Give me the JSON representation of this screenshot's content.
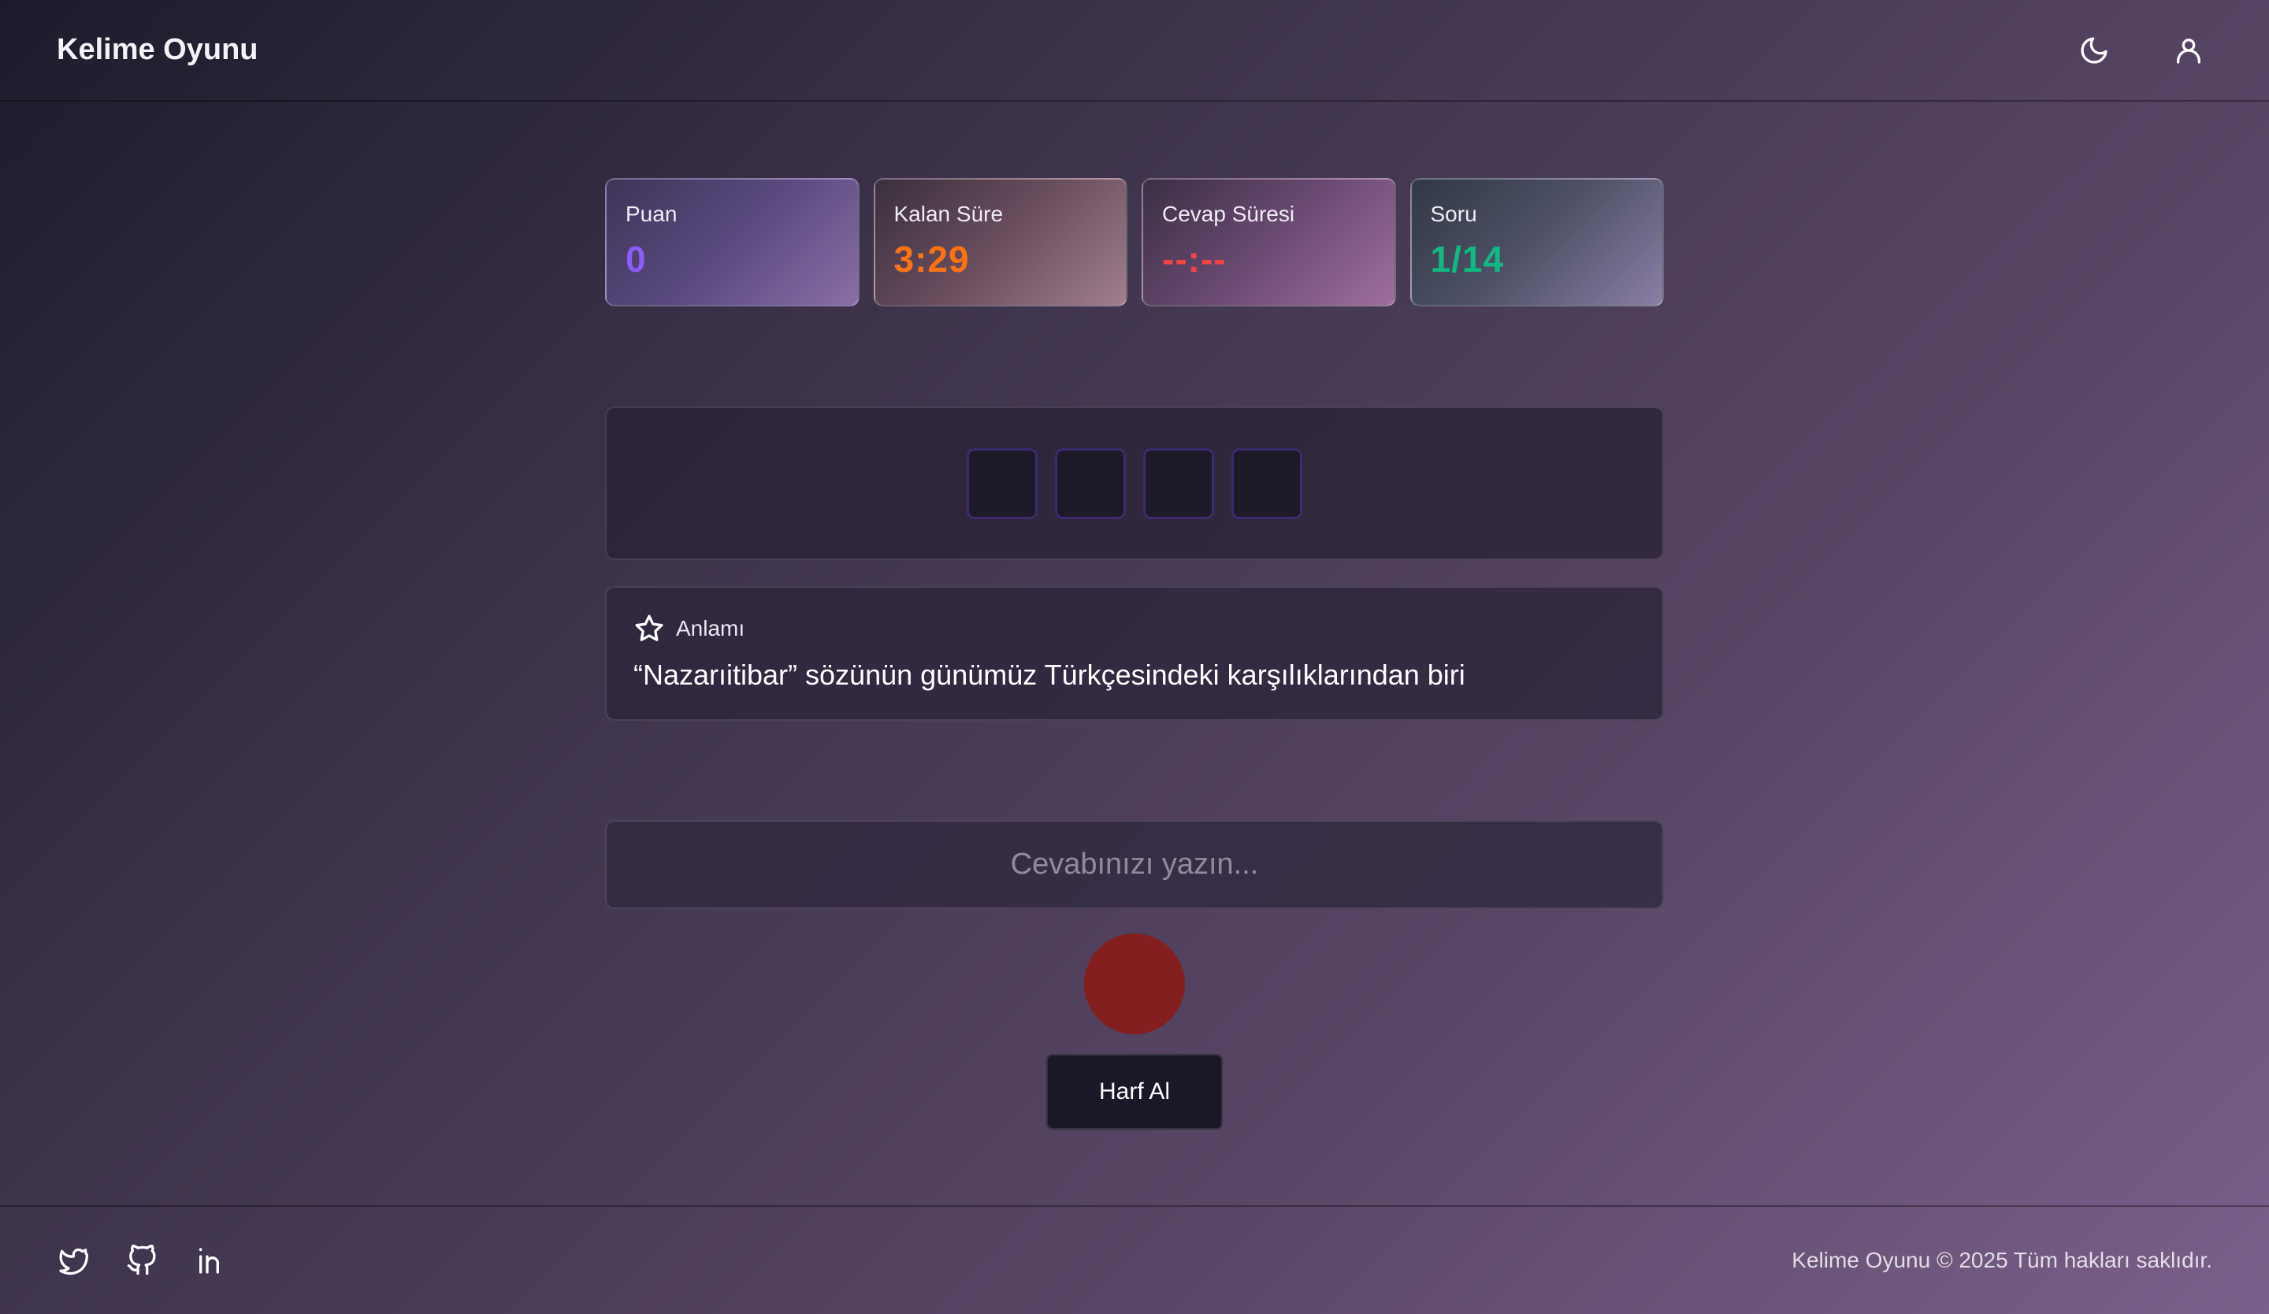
{
  "header": {
    "title": "Kelime Oyunu",
    "icons": [
      "moon-icon",
      "user-icon"
    ]
  },
  "stats": [
    {
      "label": "Puan",
      "value": "0",
      "color": "#8b5cf6"
    },
    {
      "label": "Kalan Süre",
      "value": "3:29",
      "color": "#f97316"
    },
    {
      "label": "Cevap Süresi",
      "value": "--:--",
      "color": "#ef4444"
    },
    {
      "label": "Soru",
      "value": "1/14",
      "color": "#10b981"
    }
  ],
  "board": {
    "letter_count": 4,
    "letters": [
      "",
      "",
      "",
      ""
    ]
  },
  "meaning": {
    "label": "Anlamı",
    "icon": "star-icon",
    "text": "“Nazarıitibar” sözünün günümüz Türkçesindeki karşılıklarından biri"
  },
  "answer": {
    "placeholder": "Cevabınızı yazın...",
    "value": ""
  },
  "record_button": {
    "color": "#841f1f"
  },
  "hint_button": {
    "label": "Harf Al"
  },
  "footer": {
    "socials": [
      "twitter-icon",
      "github-icon",
      "linkedin-icon"
    ],
    "copyright": "Kelime Oyunu © 2025 Tüm hakları saklıdır."
  }
}
